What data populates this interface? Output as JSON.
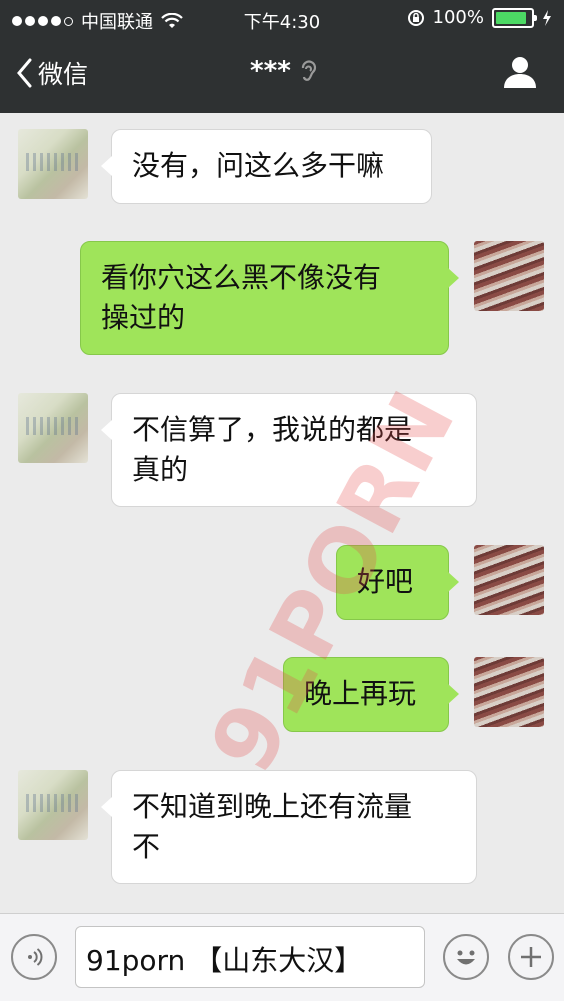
{
  "status_bar": {
    "carrier": "中国联通",
    "time": "下午4:30",
    "battery_text": "100%",
    "battery_level": 1.0,
    "signal_bars_filled": 4,
    "signal_bars_total": 5
  },
  "nav": {
    "back_label": "微信",
    "title": "***"
  },
  "messages": [
    {
      "sender": "other",
      "text": "没有，问这么多干嘛"
    },
    {
      "sender": "me",
      "text": "看你穴这么黑不像没有\n操过的"
    },
    {
      "sender": "other",
      "text": "不信算了，我说的都是\n真的"
    },
    {
      "sender": "me",
      "text": "好吧"
    },
    {
      "sender": "me",
      "text": "晚上再玩"
    },
    {
      "sender": "other",
      "text": "不知道到晚上还有流量\n不"
    }
  ],
  "input": {
    "value": "91porn 【山东大汉】"
  },
  "watermark": "91PORN",
  "colors": {
    "nav_bg": "#2e3132",
    "chat_bg": "#ebebeb",
    "my_bubble": "#9fe45a",
    "other_bubble": "#ffffff",
    "battery": "#4cd964"
  },
  "icons": {
    "back": "chevron-left-icon",
    "ear": "earpiece-mode-icon",
    "profile": "person-icon",
    "voice": "voice-icon",
    "emoji": "emoji-icon",
    "add": "plus-icon"
  }
}
